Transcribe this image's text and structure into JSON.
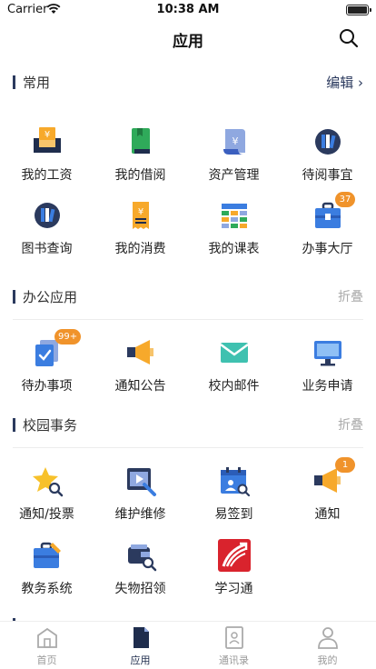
{
  "status": {
    "carrier": "Carrier",
    "time": "10:38 AM"
  },
  "navbar": {
    "title": "应用"
  },
  "sections": {
    "common": {
      "title": "常用",
      "action": "编辑 ›"
    },
    "office": {
      "title": "办公应用",
      "action": "折叠"
    },
    "campus": {
      "title": "校园事务",
      "action": "折叠"
    }
  },
  "common_items": [
    {
      "label": "我的工资"
    },
    {
      "label": "我的借阅"
    },
    {
      "label": "资产管理"
    },
    {
      "label": "待阅事宜"
    },
    {
      "label": "图书查询"
    },
    {
      "label": "我的消费"
    },
    {
      "label": "我的课表"
    },
    {
      "label": "办事大厅",
      "badge": "37"
    }
  ],
  "office_items": [
    {
      "label": "待办事项",
      "badge": "99+"
    },
    {
      "label": "通知公告"
    },
    {
      "label": "校内邮件"
    },
    {
      "label": "业务申请"
    }
  ],
  "campus_items": [
    {
      "label": "通知/投票"
    },
    {
      "label": "维护维修"
    },
    {
      "label": "易签到"
    },
    {
      "label": "通知",
      "badge": "1"
    },
    {
      "label": "教务系统"
    },
    {
      "label": "失物招领"
    },
    {
      "label": "学习通"
    }
  ],
  "tabs": [
    {
      "label": "首页"
    },
    {
      "label": "应用"
    },
    {
      "label": "通讯录"
    },
    {
      "label": "我的"
    }
  ],
  "colors": {
    "accent": "#2b3a5e",
    "orange": "#f7a92b",
    "blue": "#3b7de0",
    "green": "#2faa5a",
    "badge": "#f0932b"
  }
}
